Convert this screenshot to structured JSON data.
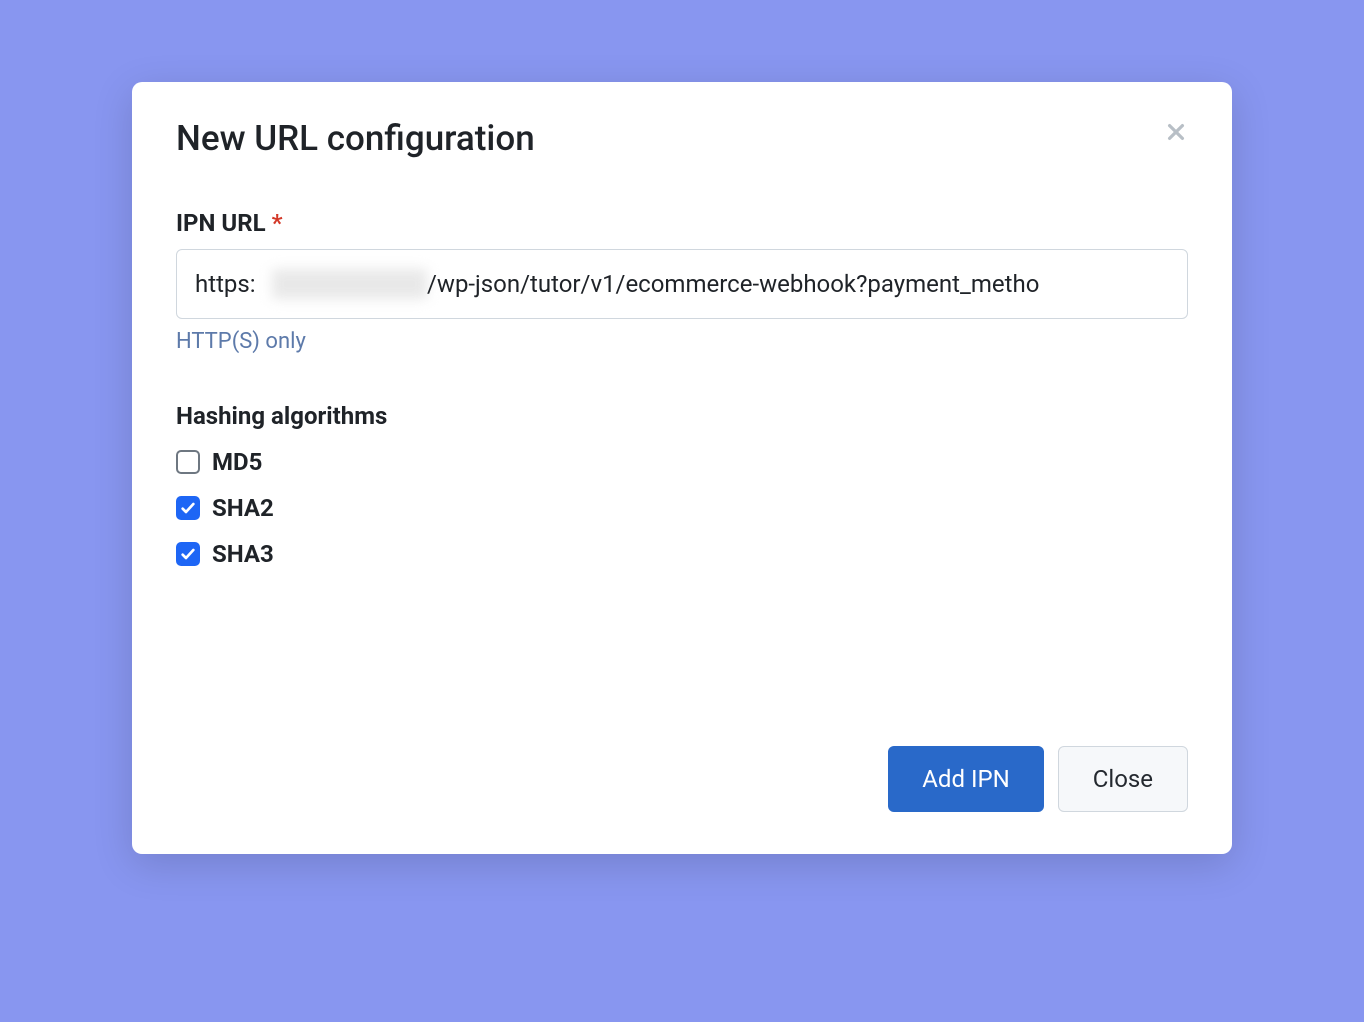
{
  "modal": {
    "title": "New URL configuration"
  },
  "ipn": {
    "label": "IPN URL",
    "required_mark": "*",
    "url_prefix": "https:",
    "url_suffix": "/wp-json/tutor/v1/ecommerce-webhook?payment_metho",
    "helper": "HTTP(S) only"
  },
  "hashing": {
    "title": "Hashing algorithms",
    "options": [
      {
        "label": "MD5",
        "checked": false
      },
      {
        "label": "SHA2",
        "checked": true
      },
      {
        "label": "SHA3",
        "checked": true
      }
    ]
  },
  "buttons": {
    "add": "Add IPN",
    "close": "Close"
  }
}
